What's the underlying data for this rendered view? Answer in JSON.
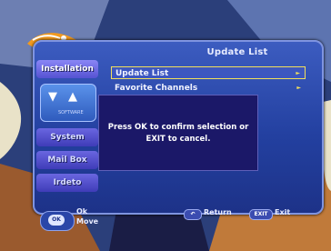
{
  "panel": {
    "title": "Update List"
  },
  "sidebar": {
    "items": [
      {
        "label": "Installation"
      },
      {
        "label": "System"
      },
      {
        "label": "Mail Box"
      },
      {
        "label": "Irdeto"
      }
    ],
    "icon_caption": "SOFTWARE"
  },
  "menu": {
    "items": [
      {
        "label": "Update List",
        "selected": true
      },
      {
        "label": "Favorite Channels",
        "selected": false
      }
    ]
  },
  "dialog": {
    "line1": "Press OK to confirm selection or",
    "line2": "EXIT to cancel."
  },
  "footer": {
    "pad_ok": "OK",
    "ok_label": "Ok",
    "move_label": "Move",
    "return_button": "↶",
    "return_label": "Return",
    "exit_button": "EXIT",
    "exit_label": "Exit"
  },
  "colors": {
    "highlight": "#f2e05c",
    "panel": "#2340a0",
    "dialog": "#1b1868"
  }
}
